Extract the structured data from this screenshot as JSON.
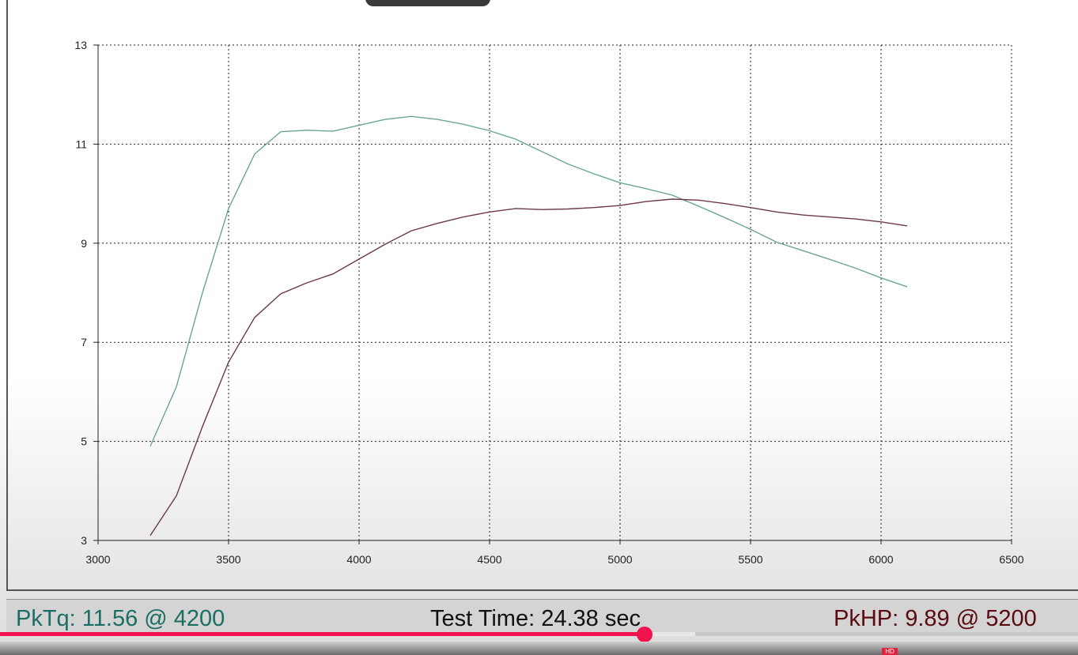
{
  "chart_data": {
    "type": "line",
    "title": "",
    "xlabel": "",
    "ylabel": "",
    "xlim": [
      3000,
      6500
    ],
    "ylim": [
      3,
      13
    ],
    "x_ticks": [
      3000,
      3500,
      4000,
      4500,
      5000,
      5500,
      6000,
      6500
    ],
    "y_ticks": [
      3,
      5,
      7,
      9,
      11,
      13
    ],
    "grid": true,
    "series": [
      {
        "color": "#6aa59a",
        "points": [
          [
            3200,
            4.9
          ],
          [
            3300,
            6.1
          ],
          [
            3400,
            8.0
          ],
          [
            3500,
            9.7
          ],
          [
            3600,
            10.8
          ],
          [
            3700,
            11.25
          ],
          [
            3800,
            11.28
          ],
          [
            3900,
            11.26
          ],
          [
            4000,
            11.38
          ],
          [
            4100,
            11.5
          ],
          [
            4200,
            11.56
          ],
          [
            4300,
            11.5
          ],
          [
            4400,
            11.4
          ],
          [
            4500,
            11.27
          ],
          [
            4600,
            11.1
          ],
          [
            4700,
            10.85
          ],
          [
            4800,
            10.6
          ],
          [
            4900,
            10.4
          ],
          [
            5000,
            10.22
          ],
          [
            5100,
            10.1
          ],
          [
            5200,
            9.97
          ],
          [
            5300,
            9.75
          ],
          [
            5400,
            9.52
          ],
          [
            5500,
            9.28
          ],
          [
            5600,
            9.02
          ],
          [
            5700,
            8.85
          ],
          [
            5800,
            8.68
          ],
          [
            5900,
            8.5
          ],
          [
            6000,
            8.3
          ],
          [
            6100,
            8.12
          ]
        ]
      },
      {
        "color": "#6b3a46",
        "points": [
          [
            3200,
            3.1
          ],
          [
            3300,
            3.9
          ],
          [
            3400,
            5.3
          ],
          [
            3500,
            6.6
          ],
          [
            3600,
            7.5
          ],
          [
            3700,
            7.98
          ],
          [
            3800,
            8.2
          ],
          [
            3900,
            8.38
          ],
          [
            4000,
            8.68
          ],
          [
            4100,
            8.98
          ],
          [
            4200,
            9.25
          ],
          [
            4300,
            9.4
          ],
          [
            4400,
            9.53
          ],
          [
            4500,
            9.63
          ],
          [
            4600,
            9.7
          ],
          [
            4700,
            9.68
          ],
          [
            4800,
            9.69
          ],
          [
            4900,
            9.72
          ],
          [
            5000,
            9.76
          ],
          [
            5100,
            9.84
          ],
          [
            5200,
            9.89
          ],
          [
            5300,
            9.87
          ],
          [
            5400,
            9.8
          ],
          [
            5500,
            9.72
          ],
          [
            5600,
            9.63
          ],
          [
            5700,
            9.57
          ],
          [
            5800,
            9.53
          ],
          [
            5900,
            9.49
          ],
          [
            6000,
            9.43
          ],
          [
            6100,
            9.35
          ]
        ]
      }
    ]
  },
  "status": {
    "peak_torque": "PkTq: 11.56 @  4200",
    "test_time": "Test Time: 24.38 sec",
    "peak_hp": "PkHP: 9.89 @  5200"
  },
  "player": {
    "progress_fraction": 0.598,
    "buffer_fraction": 0.645,
    "accent_color": "#f0134f",
    "hd_badge": "HD"
  }
}
